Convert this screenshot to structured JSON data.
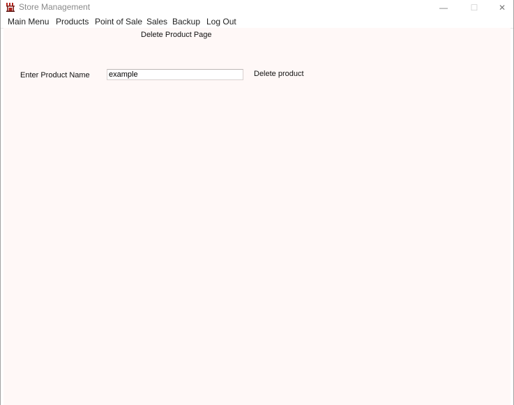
{
  "window": {
    "title": "Store Management",
    "icon": "store-awning-icon",
    "controls": {
      "minimize": "—",
      "maximize": "☐",
      "close": "✕"
    }
  },
  "menu": {
    "items": [
      "Main Menu",
      "Products",
      "Point of Sale",
      "Sales",
      "Backup",
      "Log Out"
    ]
  },
  "page": {
    "title": "Delete Product Page",
    "field_label": "Enter Product Name",
    "input_value": "example",
    "delete_label": "Delete product"
  },
  "colors": {
    "content_bg": "#fff8f7",
    "icon_red": "#b3241c"
  }
}
